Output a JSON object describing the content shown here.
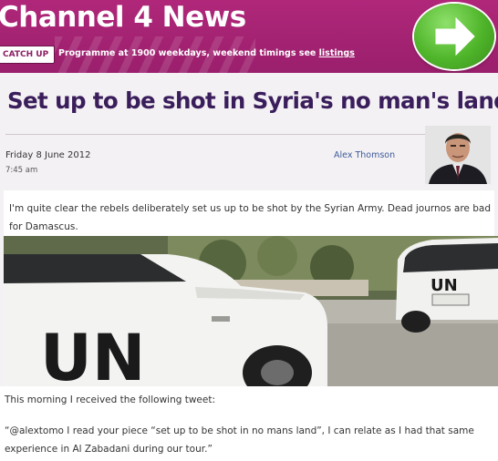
{
  "header": {
    "site_title": "Channel 4 News",
    "catchup_label": "CATCH UP",
    "programme_text": "Programme at 1900 weekdays, weekend timings see",
    "listings_link": "listings"
  },
  "icons": {
    "next": "arrow-right-icon"
  },
  "colors": {
    "header": "#a3236f",
    "headline": "#3a1e5b",
    "author": "#3b5b9a",
    "next_button": "#4fb52a"
  },
  "article": {
    "headline": "Set up to be shot in Syria's no man's land?",
    "date": "Friday 8 June 2012",
    "time": "7:45 am",
    "author": "Alex Thomson",
    "lead": "I'm quite clear the rebels deliberately set us up to be shot by the Syrian Army. Dead journos are bad for Damascus.",
    "photo_vehicle_label_left": "UN",
    "photo_vehicle_label_right": "UN",
    "para1": "This morning I received the following tweet:",
    "para2": "“@alextomo I read your piece “set up to be shot in no mans land”, I can relate as I had that same experience in Al Zabadani during our tour.”"
  }
}
